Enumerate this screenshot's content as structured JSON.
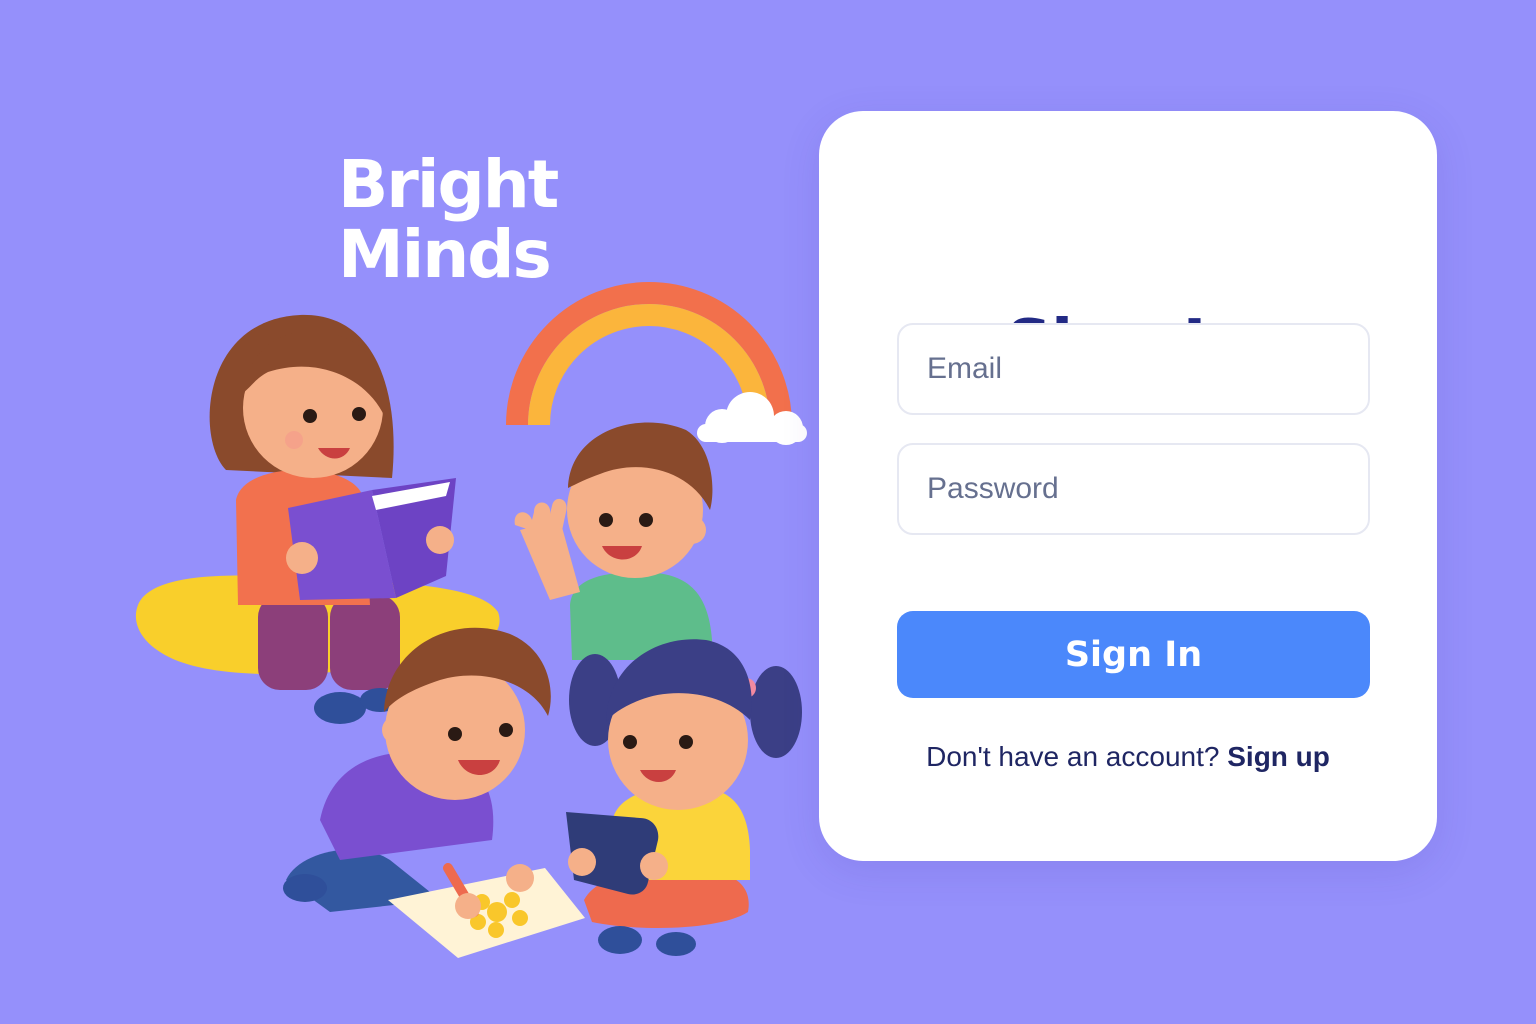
{
  "brand": {
    "line1": "Bright",
    "line2": "Minds"
  },
  "signin_card": {
    "title": "Sign In",
    "email_placeholder": "Email",
    "password_placeholder": "Password",
    "submit_label": "Sign In",
    "signup_prompt": "Don't have an account?",
    "signup_link": "Sign up"
  },
  "colors": {
    "background": "#9590fb",
    "card": "#ffffff",
    "title": "#222a85",
    "button": "#4b88fb",
    "field_border": "#e6e8f2"
  }
}
